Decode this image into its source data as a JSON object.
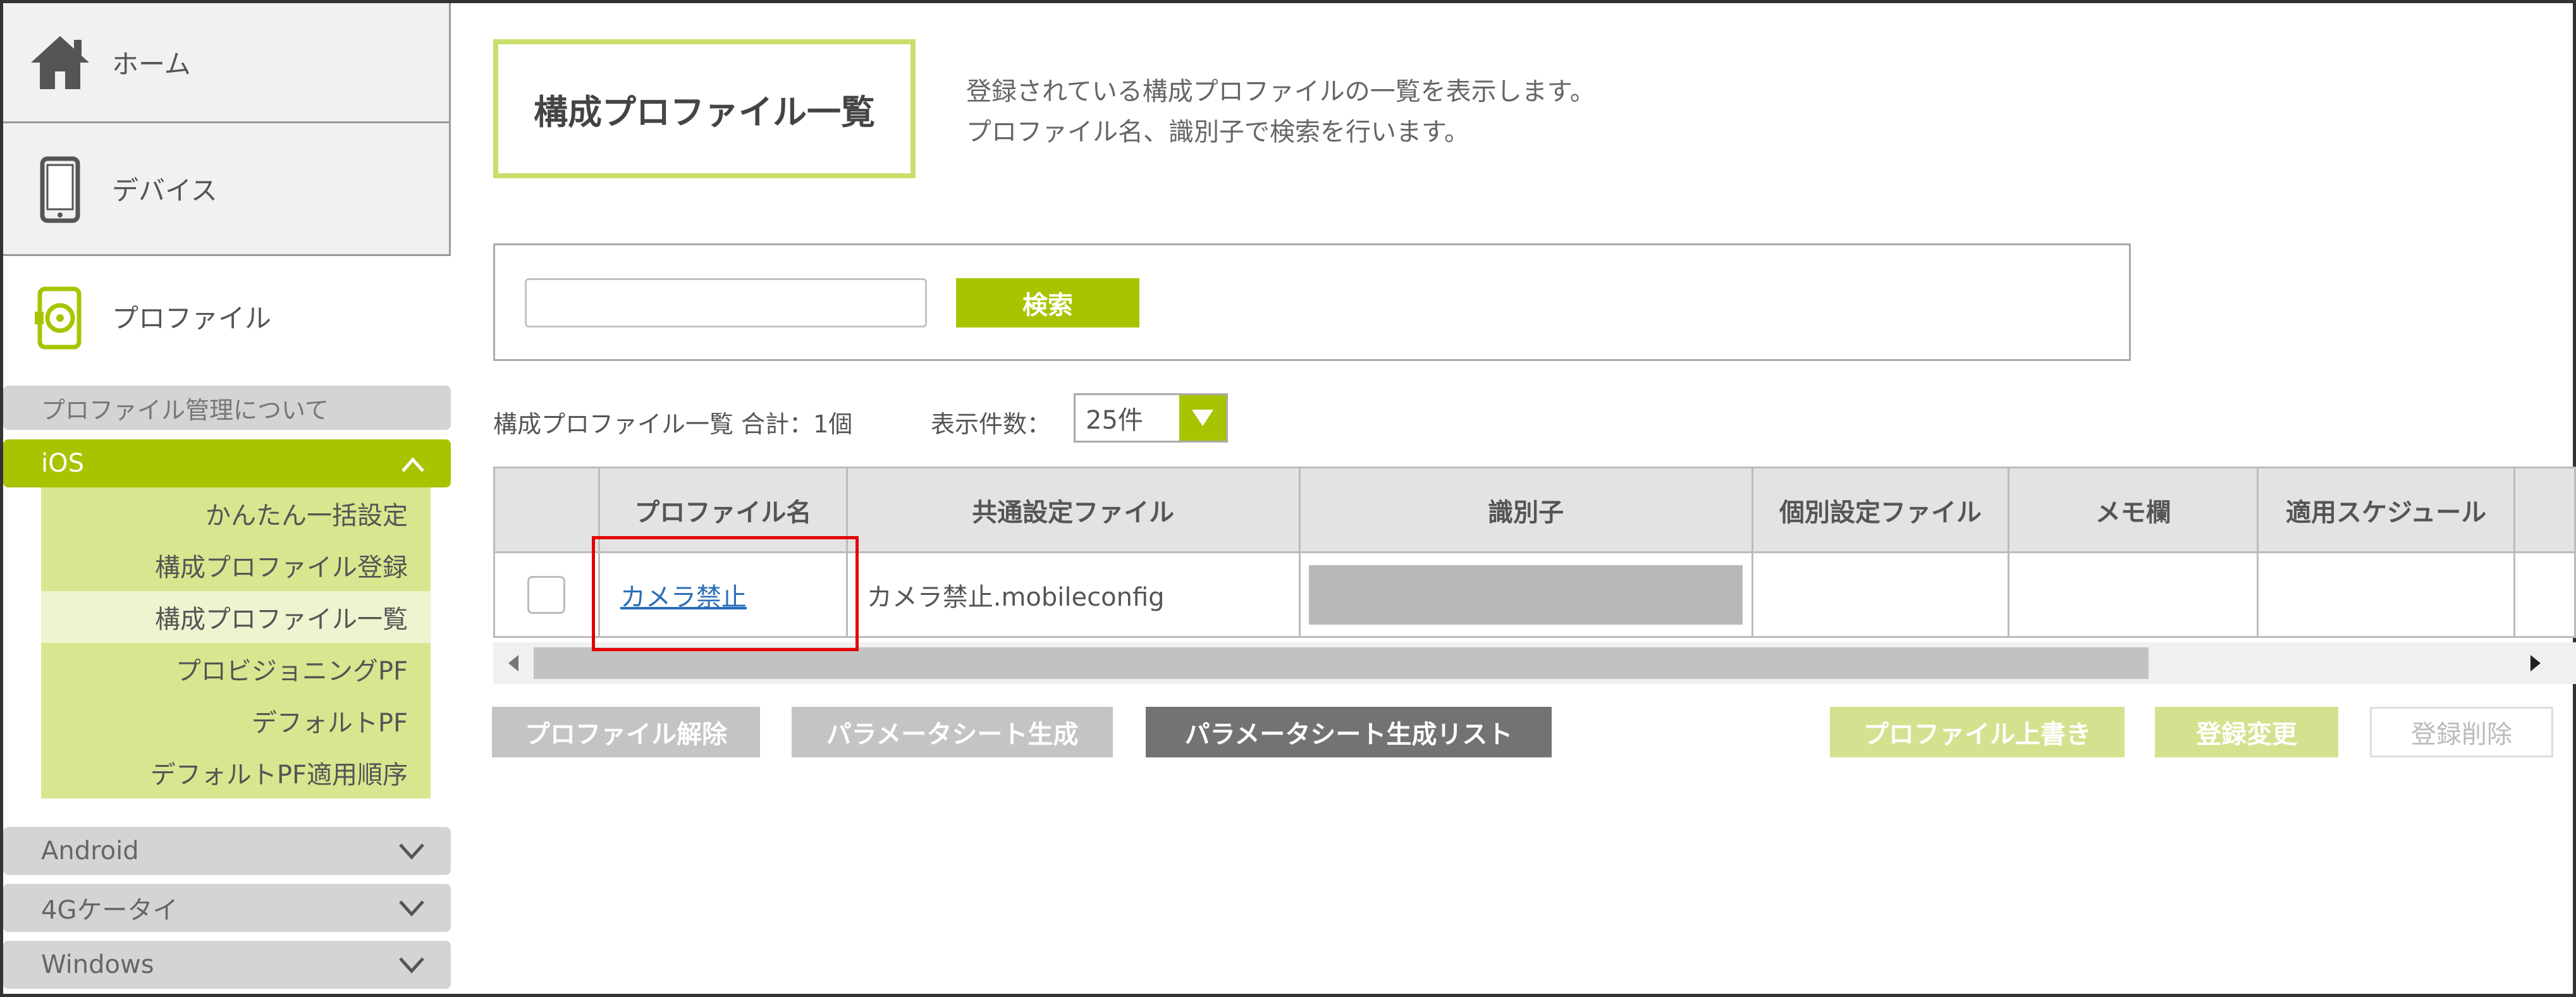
{
  "sidebar": {
    "home_label": "ホーム",
    "device_label": "デバイス",
    "profile_label": "プロファイル",
    "about_label": "プロファイル管理について",
    "ios_label": "iOS",
    "ios_items": [
      {
        "label": "かんたん一括設定"
      },
      {
        "label": "構成プロファイル登録"
      },
      {
        "label": "構成プロファイル一覧"
      },
      {
        "label": "プロビジョニングPF"
      },
      {
        "label": "デフォルトPF"
      },
      {
        "label": "デフォルトPF適用順序"
      }
    ],
    "os_rows": [
      {
        "label": "Android"
      },
      {
        "label": "4Gケータイ"
      },
      {
        "label": "Windows"
      }
    ]
  },
  "page": {
    "title": "構成プロファイル一覧",
    "description_line1": "登録されている構成プロファイルの一覧を表示します。",
    "description_line2": "プロファイル名、識別子で検索を行います。"
  },
  "search": {
    "value": "",
    "button_label": "検索"
  },
  "list": {
    "summary": "構成プロファイル一覧 合計：1個",
    "per_page_label": "表示件数：",
    "per_page_value": "25件"
  },
  "table": {
    "columns": [
      "プロファイル名",
      "共通設定ファイル",
      "識別子",
      "個別設定ファイル",
      "メモ欄",
      "適用スケジュール"
    ],
    "rows": [
      {
        "profile_name": "カメラ禁止",
        "common_file": "カメラ禁止.mobileconfig"
      }
    ]
  },
  "actions": {
    "unassign": "プロファイル解除",
    "generate_sheet": "パラメータシート生成",
    "sheet_list": "パラメータシート生成リスト",
    "overwrite": "プロファイル上書き",
    "edit": "登録変更",
    "delete": "登録削除"
  },
  "colors": {
    "accent": "#a8c400",
    "submenu_bg": "#d8e78f",
    "highlight_red": "#e30000",
    "link": "#2a6fb8"
  }
}
